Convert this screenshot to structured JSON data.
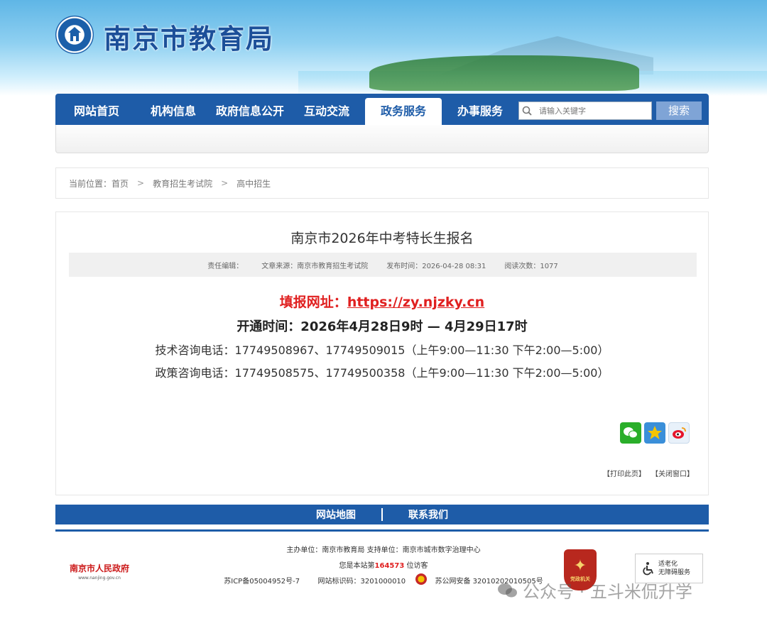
{
  "site": {
    "title": "南京市教育局"
  },
  "nav": {
    "items": [
      "网站首页",
      "机构信息",
      "政府信息公开",
      "互动交流",
      "政务服务",
      "办事服务"
    ],
    "active_index": 4,
    "search_placeholder": "请输入关键字",
    "search_button": "搜索"
  },
  "breadcrumb": {
    "label": "当前位置：",
    "items": [
      "首页",
      "教育招生考试院",
      "高中招生"
    ]
  },
  "article": {
    "title": "南京市2026年中考特长生报名",
    "meta": {
      "editor_label": "责任编辑：",
      "source": "文章来源：南京市教育招生考试院",
      "published": "发布时间：2026-04-28 08:31",
      "views": "阅读次数：1077"
    },
    "url_label": "填报网址：",
    "url": "https://zy.njzky.cn",
    "open_time": "开通时间：2026年4月28日9时 — 4月29日17时",
    "tech_phone": "技术咨询电话：17749508967、17749509015（上午9:00—11:30 下午2:00—5:00）",
    "policy_phone": "政策咨询电话：17749508575、17749500358（上午9:00—11:30 下午2:00—5:00）",
    "print": "【打印此页】",
    "close": "【关闭窗口】"
  },
  "footer": {
    "links": [
      "网站地图",
      "联系我们"
    ],
    "sponsor": "主办单位：南京市教育局  支持单位：南京市城市数字治理中心",
    "visitor_prefix": "您是本站第",
    "visitor_count": "164573",
    "visitor_suffix": "位访客",
    "icp": "苏ICP备05004952号-7",
    "site_id": "网站标识码：3201000010",
    "police": "苏公网安备 32010202010505号",
    "gov_name": "南京市人民政府",
    "gov_url": "www.nanjing.gov.cn",
    "party_label": "党政机关",
    "accessibility": [
      "适老化",
      "无障碍服务"
    ]
  },
  "watermark": "公众号 · 五斗米侃升学",
  "colors": {
    "brand_blue": "#1e5ca8",
    "accent_red": "#e02020"
  }
}
